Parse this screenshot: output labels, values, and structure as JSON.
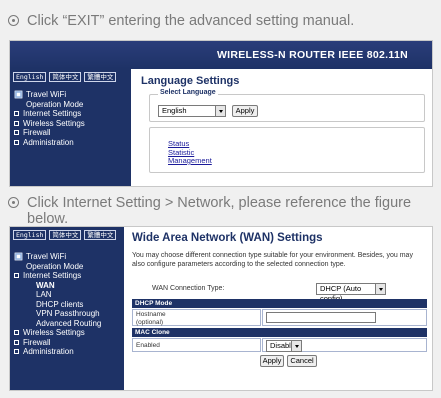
{
  "instructions": {
    "step1": "Click “EXIT” entering the advanced setting manual.",
    "step2_line1": "Click Internet Setting > Network, please reference the figure",
    "step2_line2": "below."
  },
  "panel1": {
    "header_title": "WIRELESS-N ROUTER IEEE 802.11N",
    "languages": [
      "English",
      "简体中文",
      "繁體中文"
    ],
    "nav": {
      "travel_wifi": "Travel WiFi",
      "operation_mode": "Operation Mode",
      "internet_settings": "Internet Settings",
      "wireless_settings": "Wireless Settings",
      "firewall": "Firewall",
      "administration": "Administration"
    },
    "page_title": "Language Settings",
    "select_legend": "Select Language",
    "selected_language": "English",
    "apply_label": "Apply",
    "links": [
      "Status",
      "Statistic",
      "Management"
    ]
  },
  "panel2": {
    "languages": [
      "English",
      "简体中文",
      "繁體中文"
    ],
    "nav": {
      "travel_wifi": "Travel WiFi",
      "operation_mode": "Operation Mode",
      "internet_settings": "Internet Settings",
      "wan": "WAN",
      "lan": "LAN",
      "dhcp_clients": "DHCP clients",
      "vpn_passthrough": "VPN Passthrough",
      "advanced_routing": "Advanced Routing",
      "wireless_settings": "Wireless Settings",
      "firewall": "Firewall",
      "administration": "Administration"
    },
    "page_title": "Wide Area Network (WAN) Settings",
    "description": "You may choose different connection type suitable for your environment. Besides, you may also configure parameters according to the selected connection type.",
    "wan_connection_label": "WAN Connection Type:",
    "wan_connection_value": "DHCP (Auto config)",
    "dhcp_mode_header": "DHCP Mode",
    "hostname_label": "Hostname",
    "hostname_sublabel": "(optional)",
    "hostname_value": "",
    "mac_clone_header": "MAC Clone",
    "enabled_label": "Enabled",
    "enabled_value": "Disable",
    "apply_label": "Apply",
    "cancel_label": "Cancel"
  },
  "colors": {
    "navy": "#1e3266",
    "bullet_text": "#7a7a7a"
  }
}
